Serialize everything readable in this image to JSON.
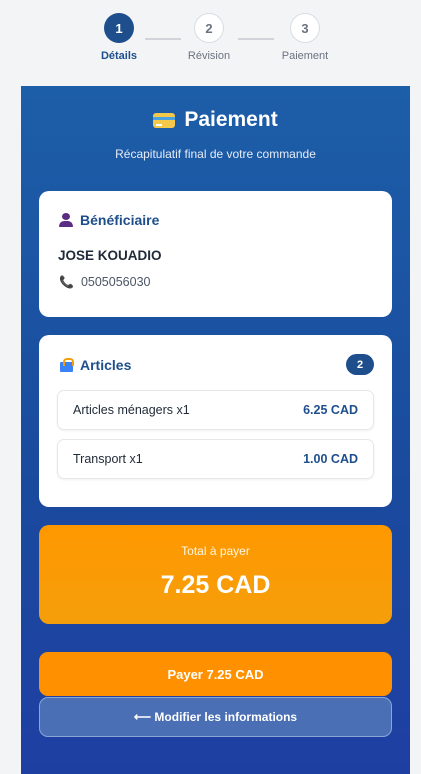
{
  "stepper": {
    "steps": [
      {
        "number": "1",
        "label": "Détails",
        "state": "active"
      },
      {
        "number": "2",
        "label": "Révision",
        "state": "inactive"
      },
      {
        "number": "3",
        "label": "Paiement",
        "state": "inactive"
      }
    ]
  },
  "header": {
    "icon": "credit-card-icon",
    "title": "Paiement",
    "subtitle": "Récapitulatif final de votre commande"
  },
  "beneficiary": {
    "icon": "person-icon",
    "heading": "Bénéficiaire",
    "name": "JOSE KOUADIO",
    "phone_icon": "phone-icon",
    "phone": "0505056030"
  },
  "articles": {
    "icon": "shopping-bag-icon",
    "heading": "Articles",
    "count": "2",
    "items": [
      {
        "name": "Articles ménagers x1",
        "price": "6.25 CAD"
      },
      {
        "name": "Transport x1",
        "price": "1.00 CAD"
      }
    ]
  },
  "total": {
    "label": "Total à payer",
    "value": "7.25 CAD"
  },
  "actions": {
    "pay_label": "Payer 7.25 CAD",
    "edit_label": "⟵ Modifier les informations"
  },
  "colors": {
    "primary": "#1e4f8c",
    "accent": "#ff9800",
    "panel": "#1a4b9e"
  }
}
